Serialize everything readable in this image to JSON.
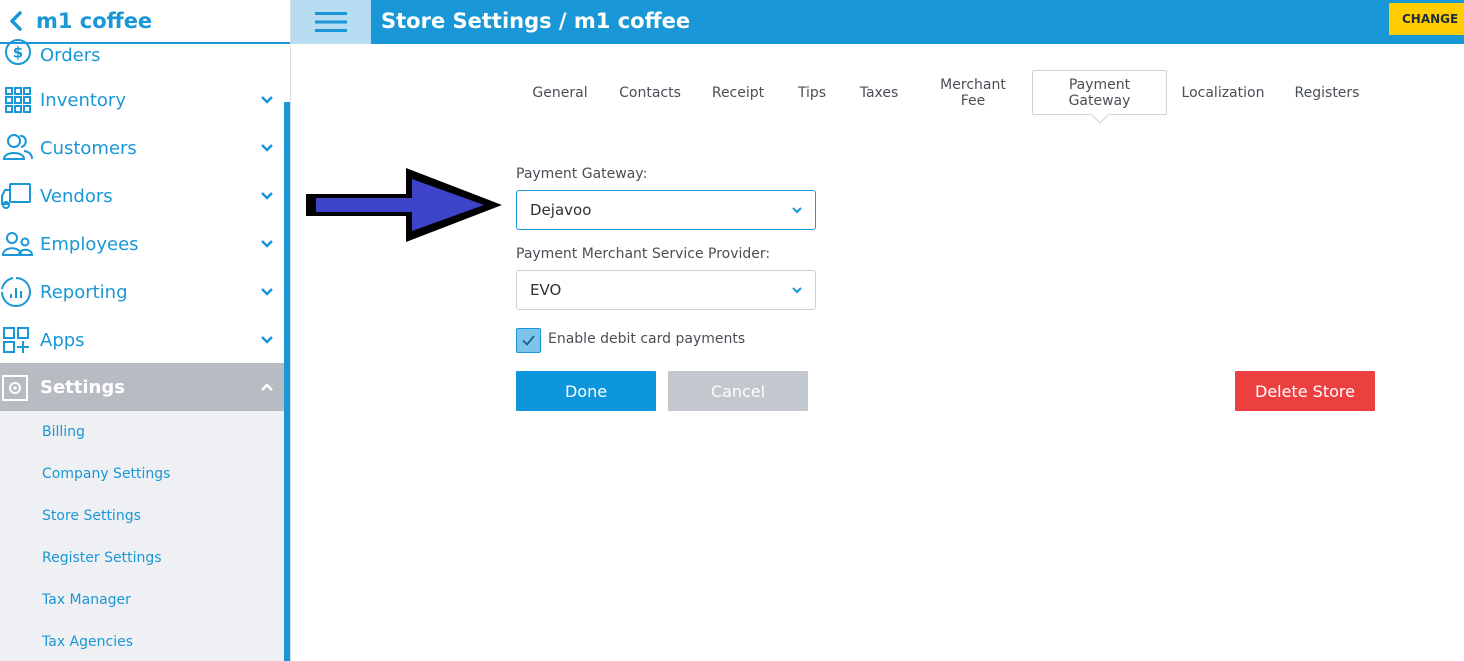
{
  "sidebar": {
    "store_name": "m1 coffee",
    "items": [
      {
        "label": "Orders",
        "icon": "dollar-circle-icon"
      },
      {
        "label": "Inventory",
        "icon": "grid-icon"
      },
      {
        "label": "Customers",
        "icon": "users-icon"
      },
      {
        "label": "Vendors",
        "icon": "truck-icon"
      },
      {
        "label": "Employees",
        "icon": "employees-icon"
      },
      {
        "label": "Reporting",
        "icon": "chart-circle-icon"
      },
      {
        "label": "Apps",
        "icon": "apps-icon"
      },
      {
        "label": "Settings",
        "icon": "gear-icon"
      }
    ],
    "settings_sub": [
      "Billing",
      "Company Settings",
      "Store Settings",
      "Register Settings",
      "Tax Manager",
      "Tax Agencies"
    ]
  },
  "header": {
    "title": "Store Settings / m1 coffee",
    "change_label": "CHANGE"
  },
  "tabs": {
    "general": "General",
    "contacts": "Contacts",
    "receipt": "Receipt",
    "tips": "Tips",
    "taxes": "Taxes",
    "merchant_fee_1": "Merchant",
    "merchant_fee_2": "Fee",
    "payment_gateway_1": "Payment",
    "payment_gateway_2": "Gateway",
    "localization": "Localization",
    "registers": "Registers",
    "active": "Payment Gateway"
  },
  "form": {
    "gateway_label": "Payment Gateway:",
    "gateway_value": "Dejavoo",
    "provider_label": "Payment Merchant Service Provider:",
    "provider_value": "EVO",
    "debit_label": "Enable debit card payments",
    "debit_checked": true
  },
  "buttons": {
    "done": "Done",
    "cancel": "Cancel",
    "delete": "Delete Store"
  },
  "colors": {
    "accent": "#1a97d6",
    "change": "#ffcc00",
    "delete": "#ec4040",
    "arrow_fill": "#3d44c9"
  }
}
